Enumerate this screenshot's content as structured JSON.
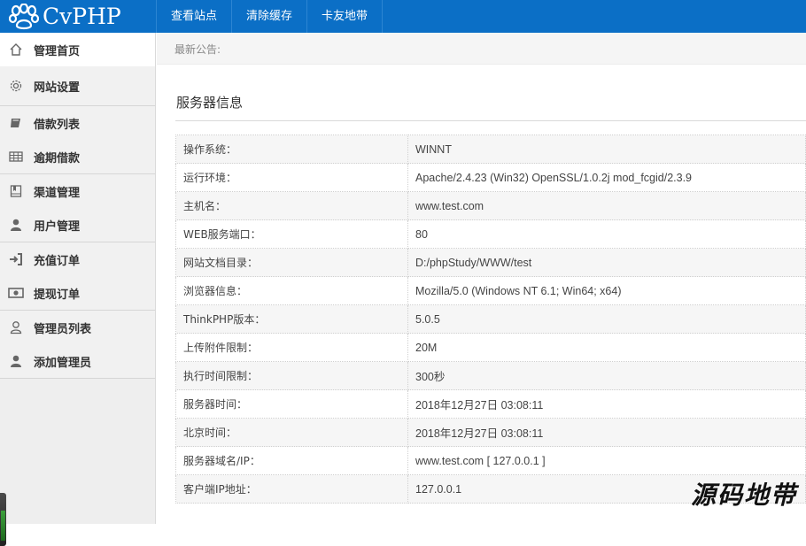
{
  "brand": {
    "name": "CvPHP",
    "icon": "paw-icon"
  },
  "topnav": [
    {
      "label": "查看站点"
    },
    {
      "label": "清除缓存"
    },
    {
      "label": "卡友地带"
    }
  ],
  "sidebar": {
    "items": [
      {
        "label": "管理首页",
        "icon": "home-icon"
      },
      {
        "label": "网站设置",
        "icon": "gear-icon"
      },
      {
        "label": "借款列表",
        "icon": "book-icon"
      },
      {
        "label": "逾期借款",
        "icon": "table-icon"
      },
      {
        "label": "渠道管理",
        "icon": "bookmark-icon"
      },
      {
        "label": "用户管理",
        "icon": "user-icon"
      },
      {
        "label": "充值订单",
        "icon": "sign-in-icon"
      },
      {
        "label": "提现订单",
        "icon": "money-icon"
      },
      {
        "label": "管理员列表",
        "icon": "user-outline-icon"
      },
      {
        "label": "添加管理员",
        "icon": "user-icon"
      }
    ]
  },
  "notice": {
    "label": "最新公告:"
  },
  "section": {
    "title": "服务器信息"
  },
  "server_info": [
    {
      "key": "操作系统：",
      "value": "WINNT"
    },
    {
      "key": "运行环境：",
      "value": "Apache/2.4.23 (Win32) OpenSSL/1.0.2j mod_fcgid/2.3.9"
    },
    {
      "key": "主机名：",
      "value": "www.test.com"
    },
    {
      "key": "WEB服务端口：",
      "value": "80"
    },
    {
      "key": "网站文档目录：",
      "value": "D:/phpStudy/WWW/test"
    },
    {
      "key": "浏览器信息：",
      "value": "Mozilla/5.0 (Windows NT 6.1; Win64; x64)"
    },
    {
      "key": "ThinkPHP版本：",
      "value": "5.0.5"
    },
    {
      "key": "上传附件限制：",
      "value": "20M"
    },
    {
      "key": "执行时间限制：",
      "value": "300秒"
    },
    {
      "key": "服务器时间：",
      "value": "2018年12月27日 03:08:11"
    },
    {
      "key": "北京时间：",
      "value": "2018年12月27日 03:08:11"
    },
    {
      "key": "服务器域名/IP：",
      "value": "www.test.com [ 127.0.0.1 ]"
    },
    {
      "key": "客户端IP地址：",
      "value": "127.0.0.1"
    }
  ],
  "watermark": "源码地带",
  "colors": {
    "topbar": "#0b6fc6",
    "sidebar": "#eeeeee"
  }
}
